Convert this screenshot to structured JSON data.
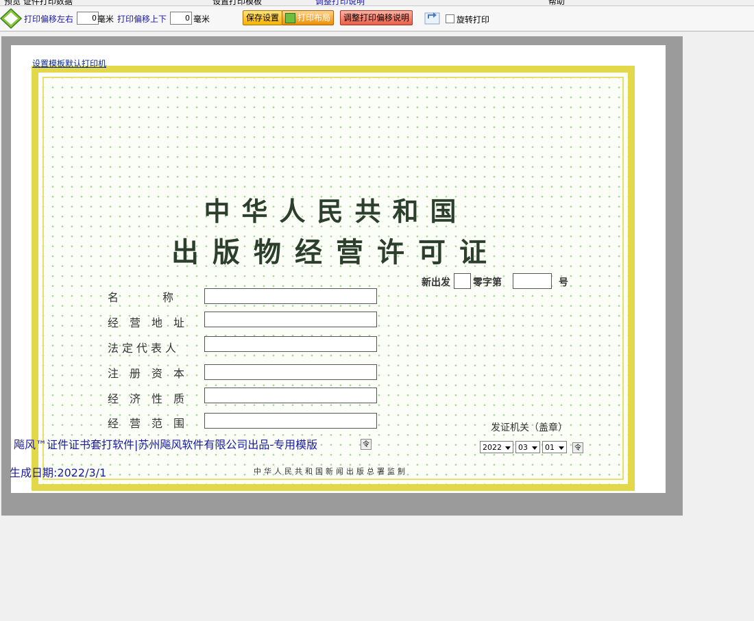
{
  "menu_strip": {
    "text_left": "预览  证件打印数据",
    "text_mid": "设置打印模板",
    "text_link": "调整打印说明",
    "text_right": "帮助"
  },
  "toolbar": {
    "offset_lr_label": "打印偏移左右",
    "offset_lr_value": "0",
    "unit_mm_1": "毫米",
    "offset_ud_label": "打印偏移上下",
    "offset_ud_value": "0",
    "unit_mm_2": "毫米",
    "save_label": "保存设置",
    "layout_label": "打印布局",
    "help_label": "调整打印偏移说明",
    "rotate_label": "旋转打印"
  },
  "certificate": {
    "printer_link": "设置模板默认打印机",
    "title_line1": "中华人民共和国",
    "title_line2": "出版物经营许可证",
    "serial_prefix": "新出发",
    "serial_mid": "零字第",
    "serial_suffix": "号",
    "labels": {
      "name": "名　　　　称",
      "address": "经　营　地　址",
      "legal_rep": "法定代表人",
      "capital": "注　册　资　本",
      "nature": "经　济　性　质",
      "scope": "经　营　范　围"
    },
    "issuer": "发证机关（盖章）",
    "date_year": "2022",
    "date_month": "03",
    "date_day": "01",
    "calc_icon": "令",
    "supervisor": "中华人民共和国新闻出版总署监制"
  },
  "overlay": {
    "watermark": "飚风™证件证书套打软件|苏州飚风软件有限公司出品-专用模版",
    "generated": "生成日期:2022/3/1"
  },
  "colors": {
    "border_gold": "#e3d84a",
    "pattern_green": "#a9d59a",
    "title_ink": "#2c3e2c",
    "overlay_blue": "#1a1aa0"
  }
}
